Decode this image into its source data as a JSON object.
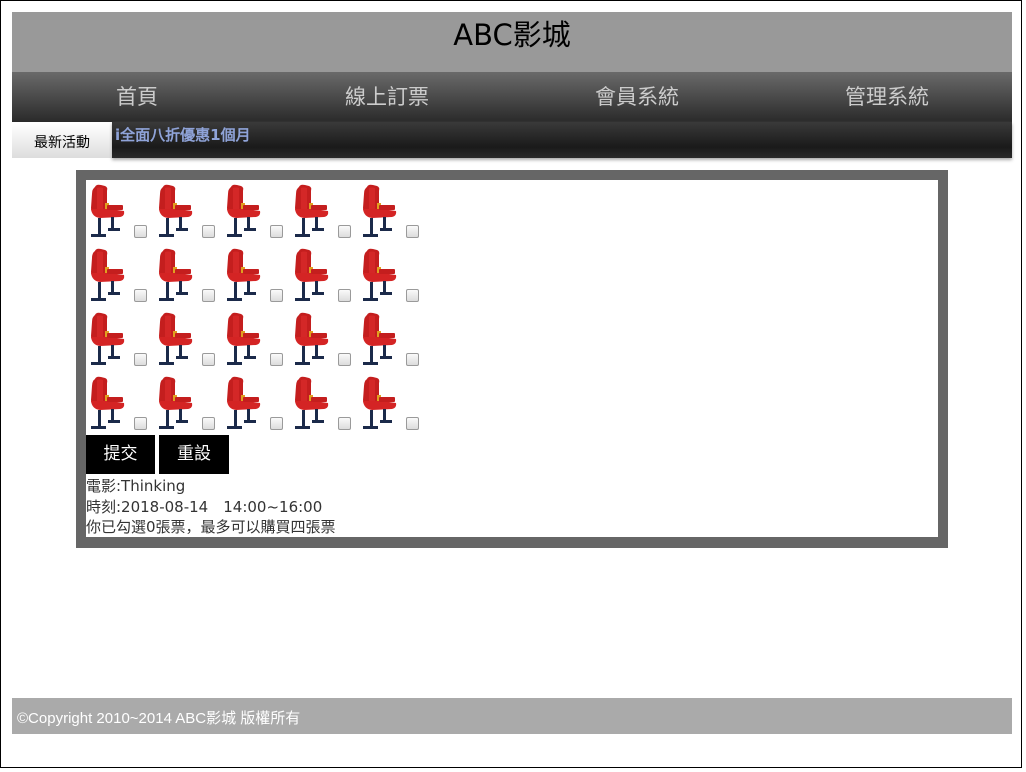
{
  "header": {
    "title": "ABC影城"
  },
  "nav": {
    "items": [
      {
        "label": "首頁"
      },
      {
        "label": "線上訂票"
      },
      {
        "label": "會員系統"
      },
      {
        "label": "管理系統"
      }
    ]
  },
  "news": {
    "label": "最新活動",
    "marquee": "i全面八折優惠1個月"
  },
  "seats": {
    "rows": 4,
    "cols": 5,
    "icon": "theater-seat-icon",
    "checked": 0
  },
  "buttons": {
    "submit": "提交",
    "reset": "重設"
  },
  "info": {
    "movie": "電影:Thinking",
    "time": "時刻:2018-08-14　14:00~16:00",
    "status": "你已勾選0張票，最多可以購買四張票"
  },
  "footer": {
    "copyright": "©Copyright 2010~2014 ABC影城 版權所有"
  },
  "colors": {
    "header_bg": "#999999",
    "nav_start": "#6a6a6a",
    "nav_end": "#2a2a2a",
    "panel_border": "#666666",
    "seat_red": "#cc2222",
    "footer_bg": "#aaaaaa",
    "news_link": "#8fa3d8"
  }
}
